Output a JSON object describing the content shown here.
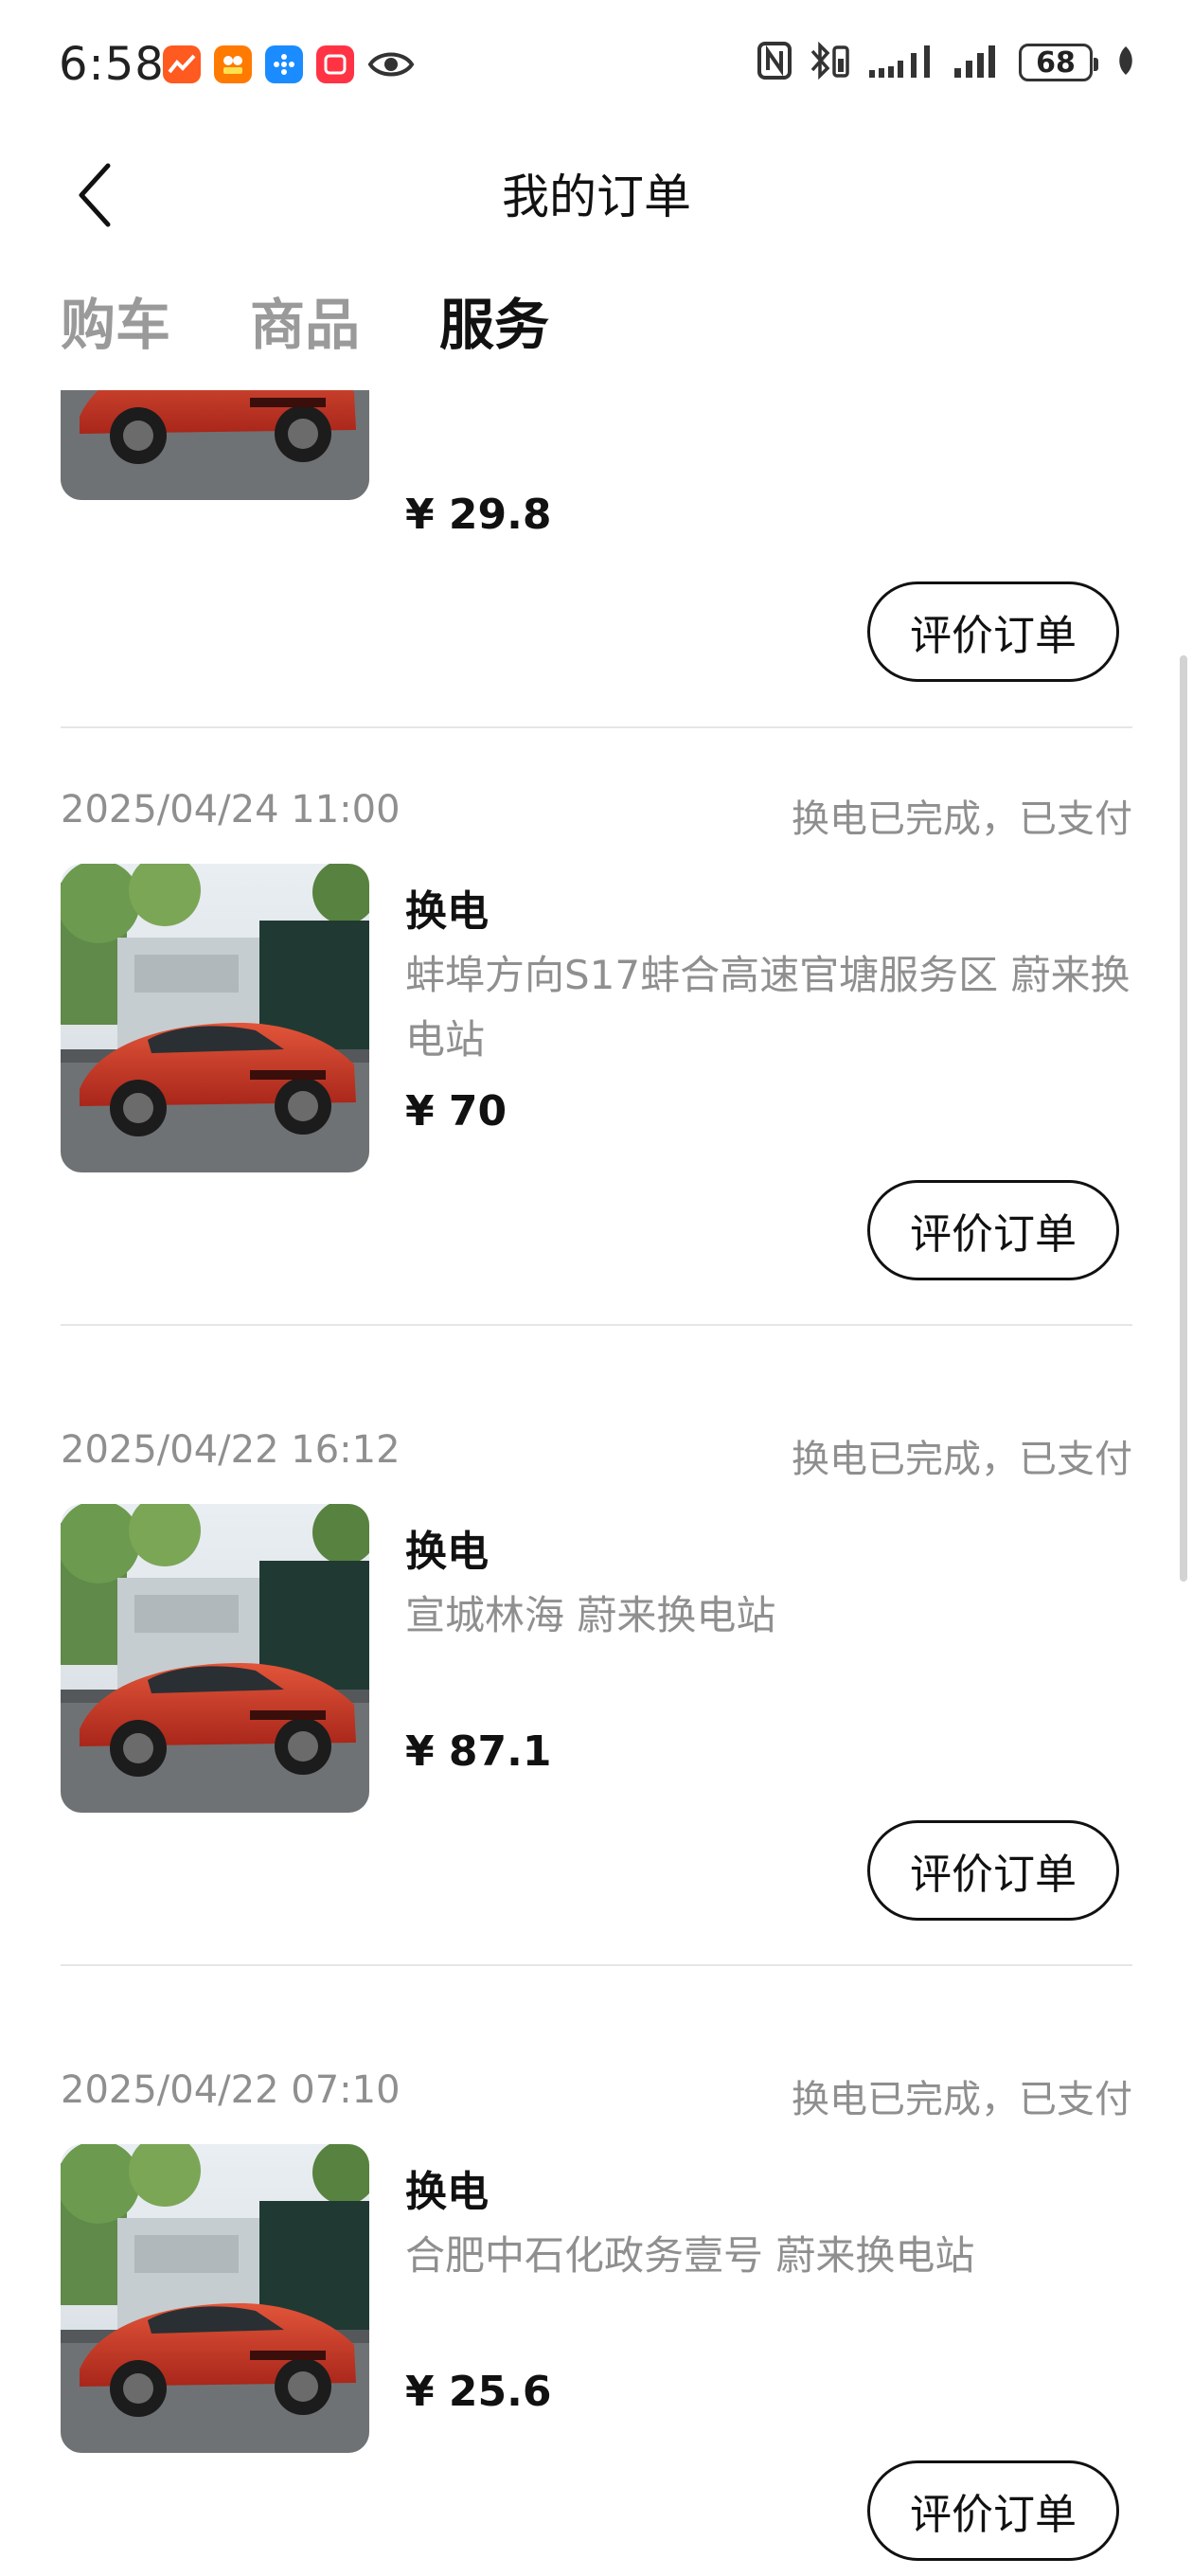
{
  "status_bar": {
    "time": "6:58",
    "app_icons": [
      "stocks-app-icon",
      "shopping-app-icon",
      "link-app-icon",
      "notes-app-icon",
      "eye-icon"
    ],
    "battery": "68"
  },
  "header": {
    "title": "我的订单",
    "back_icon": "chevron-left-icon"
  },
  "tabs": [
    {
      "label": "购车",
      "active": false
    },
    {
      "label": "商品",
      "active": false
    },
    {
      "label": "服务",
      "active": true
    }
  ],
  "orders": [
    {
      "price": "¥ 29.8",
      "button": "评价订单"
    },
    {
      "date": "2025/04/24 11:00",
      "status": "换电已完成，已支付",
      "service": "换电",
      "location": "蚌埠方向S17蚌合高速官塘服务区 蔚来换电站",
      "price": "¥ 70",
      "button": "评价订单"
    },
    {
      "date": "2025/04/22 16:12",
      "status": "换电已完成，已支付",
      "service": "换电",
      "location": "宣城林海 蔚来换电站",
      "price": "¥ 87.1",
      "button": "评价订单"
    },
    {
      "date": "2025/04/22 07:10",
      "status": "换电已完成，已支付",
      "service": "换电",
      "location": "合肥中石化政务壹号 蔚来换电站",
      "price": "¥ 25.6",
      "button": "评价订单"
    }
  ],
  "colors": {
    "accent_text": "#111111",
    "muted_text": "#8f8f8f",
    "car_red": "#c8341f"
  }
}
